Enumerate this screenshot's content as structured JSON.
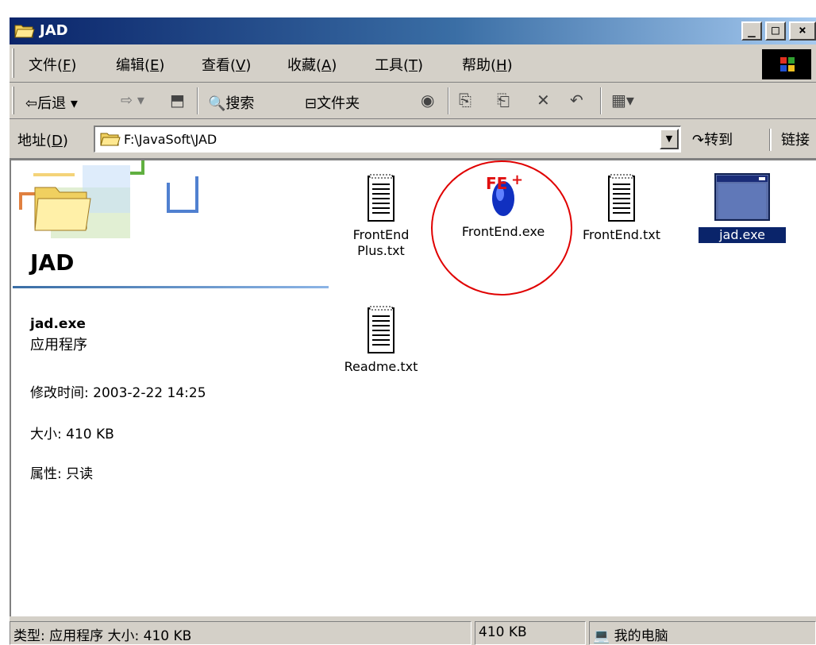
{
  "window": {
    "title": "JAD"
  },
  "menu": [
    {
      "label": "文件(",
      "acc": "F",
      "end": ")"
    },
    {
      "label": "编辑(",
      "acc": "E",
      "end": ")"
    },
    {
      "label": "查看(",
      "acc": "V",
      "end": ")"
    },
    {
      "label": "收藏(",
      "acc": "A",
      "end": ")"
    },
    {
      "label": "工具(",
      "acc": "T",
      "end": ")"
    },
    {
      "label": "帮助(",
      "acc": "H",
      "end": ")"
    }
  ],
  "toolbar": {
    "back": "后退",
    "search": "搜索",
    "folders": "文件夹"
  },
  "address": {
    "label_pre": "地址(",
    "label_acc": "D",
    "label_post": ")",
    "path": "F:\\JavaSoft\\JAD",
    "go": "转到",
    "links": "链接"
  },
  "webview": {
    "folder_name": "JAD",
    "selected_name": "jad.exe",
    "selected_type": "应用程序",
    "modified": "修改时间: 2003-2-22 14:25",
    "size": "大小: 410 KB",
    "attributes": "属性: 只读"
  },
  "files": [
    {
      "name": "FrontEnd",
      "name2": "Plus.txt"
    },
    {
      "name": "FrontEnd.exe"
    },
    {
      "name": "FrontEnd.txt"
    },
    {
      "name": "jad.exe"
    },
    {
      "name": "Readme.txt"
    }
  ],
  "status": {
    "left": "类型: 应用程序 大小: 410 KB",
    "size": "410 KB",
    "zone": "我的电脑"
  },
  "colors": {
    "titlebar": "#0a246a",
    "selection": "#0a246a",
    "annotation": "#e00000"
  }
}
